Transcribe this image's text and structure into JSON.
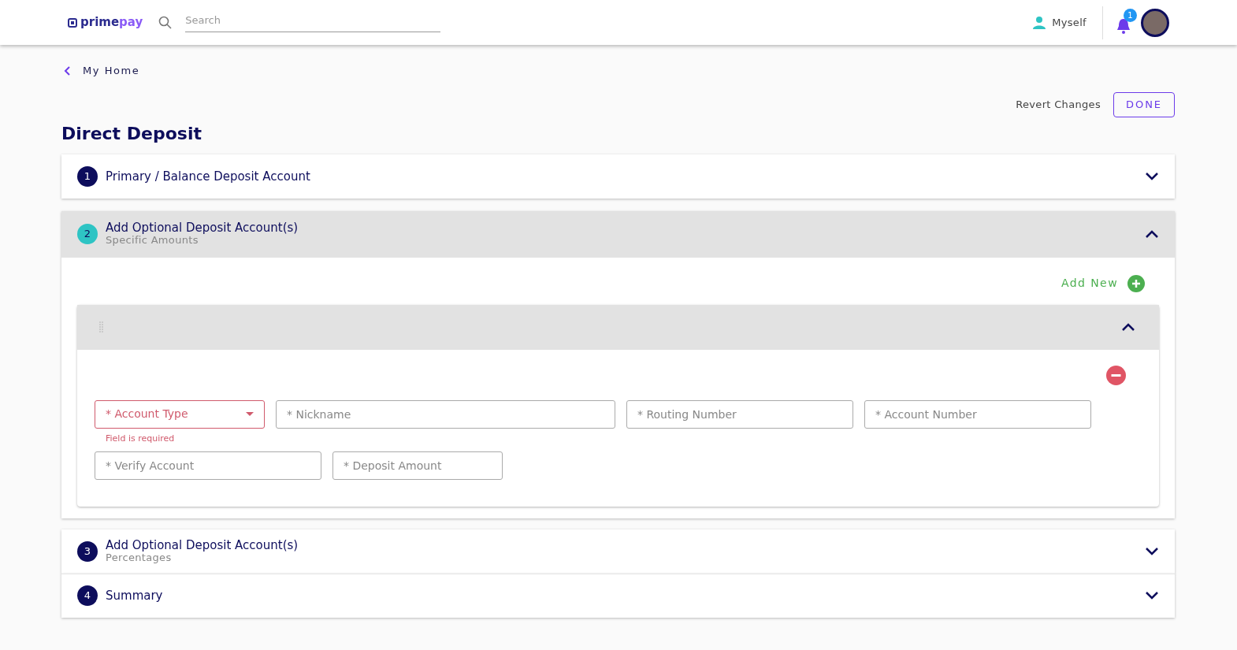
{
  "header": {
    "logo": {
      "prefix": "prime",
      "suffix": "pay"
    },
    "search": {
      "placeholder": "Search"
    },
    "user": "Myself",
    "notifications": "1"
  },
  "back_link": "My Home",
  "actions": {
    "revert": "Revert Changes",
    "done": "DONE"
  },
  "title": "Direct Deposit",
  "sections": [
    {
      "number": "1",
      "title": "Primary / Balance Deposit Account",
      "expanded": false
    },
    {
      "number": "2",
      "title": "Add Optional Deposit Account(s)",
      "subtitle": "Specific Amounts",
      "expanded": true,
      "add_new": "Add New",
      "accounts": [
        {
          "expanded": true,
          "field_rows": [
            [
              {
                "kind": "select",
                "placeholder": "* Account Type",
                "error": "Field is required"
              },
              {
                "kind": "text",
                "placeholder": "* Nickname"
              },
              {
                "kind": "text",
                "placeholder": "* Routing Number"
              },
              {
                "kind": "text",
                "placeholder": "* Account Number"
              }
            ],
            [
              {
                "kind": "text",
                "placeholder": "* Verify Account"
              },
              {
                "kind": "text",
                "placeholder": "* Deposit Amount"
              }
            ]
          ]
        }
      ]
    },
    {
      "number": "3",
      "title": "Add Optional Deposit Account(s)",
      "subtitle": "Percentages",
      "expanded": false
    },
    {
      "number": "4",
      "title": "Summary",
      "expanded": false
    }
  ]
}
